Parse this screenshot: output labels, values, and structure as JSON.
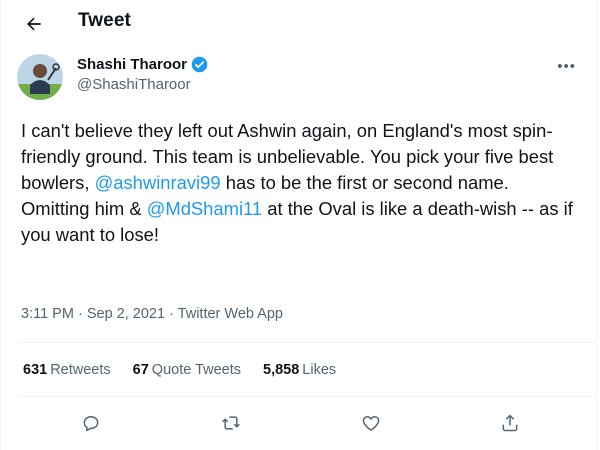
{
  "header": {
    "title": "Tweet"
  },
  "author": {
    "display_name": "Shashi Tharoor",
    "handle": "@ShashiTharoor",
    "verified": true
  },
  "tweet": {
    "text_1": "I can't believe they left out Ashwin again, on England's most spin-friendly ground. This team is unbelievable. You pick your five best bowlers, ",
    "mention_1": "@ashwinravi99",
    "text_2": " has to be the first or second name. Omitting him & ",
    "mention_2": "@MdShami11",
    "text_3": " at the Oval is like a death-wish -- as if you want to lose!"
  },
  "meta": {
    "time": "3:11 PM",
    "separator": " · ",
    "date": "Sep 2, 2021",
    "source": "Twitter Web App"
  },
  "stats": {
    "retweets_count": "631",
    "retweets_label": "Retweets",
    "quote_count": "67",
    "quote_label": "Quote Tweets",
    "likes_count": "5,858",
    "likes_label": "Likes"
  },
  "colors": {
    "accent": "#1d9bf0",
    "secondary_text": "#536471",
    "divider": "#eff3f4"
  },
  "icons": [
    "back-arrow-icon",
    "verified-badge-icon",
    "more-icon",
    "reply-icon",
    "retweet-icon",
    "like-icon",
    "share-icon"
  ]
}
